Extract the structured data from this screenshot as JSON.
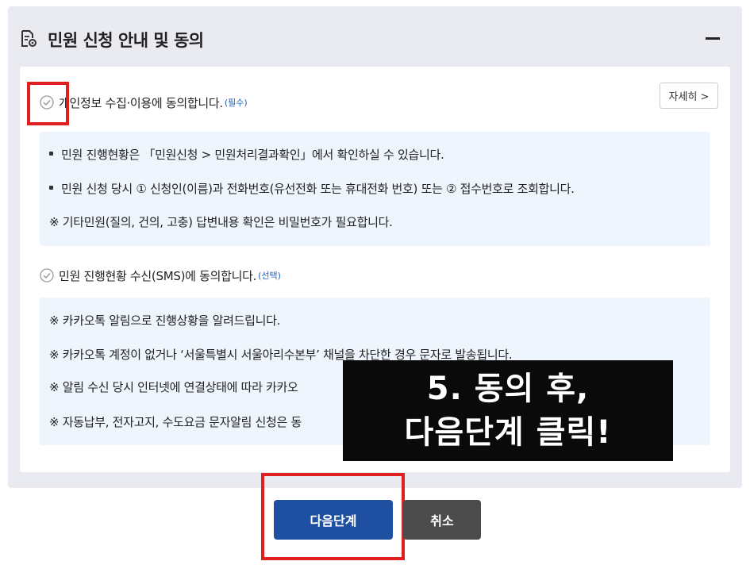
{
  "section": {
    "title": "민원 신청 안내 및 동의",
    "icon": "document-gear-icon",
    "collapse_icon": "minus-icon"
  },
  "consent1": {
    "label": "개인정보 수집·이용에 동의합니다.",
    "tag": "(필수)",
    "detail_button": "자세히 >",
    "lines": [
      "민원 진행현황은 「민원신청 > 민원처리결과확인」에서 확인하실 수 있습니다.",
      "민원 신청 당시 ① 신청인(이름)과 전화번호(유선전화 또는 휴대전화 번호) 또는 ② 접수번호로 조회합니다.",
      "※ 기타민원(질의, 건의, 고충) 답변내용 확인은 비밀번호가 필요합니다."
    ]
  },
  "consent2": {
    "label": "민원 진행현황 수신(SMS)에 동의합니다.",
    "tag": "(선택)",
    "lines": [
      "※ 카카오톡 알림으로 진행상황을 알려드립니다.",
      "※ 카카오톡 계정이 없거나 ‘서울특별시 서울아리수본부’ 채널을 차단한 경우 문자로 발송됩니다.",
      "※ 알림 수신 당시 인터넷에 연결상태에 따라 카카오",
      "※ 자동납부, 전자고지, 수도요금 문자알림 신청은 동"
    ]
  },
  "overlay": {
    "line1": "5. 동의 후,",
    "line2": "다음단계 클릭!"
  },
  "buttons": {
    "next": "다음단계",
    "cancel": "취소"
  },
  "colors": {
    "panel_bg": "#e9ebf0",
    "info_bg": "#eef5fd",
    "primary": "#1f4fa0",
    "secondary": "#4b4b4b",
    "highlight": "#e02020",
    "tag": "#1d5fbf"
  }
}
